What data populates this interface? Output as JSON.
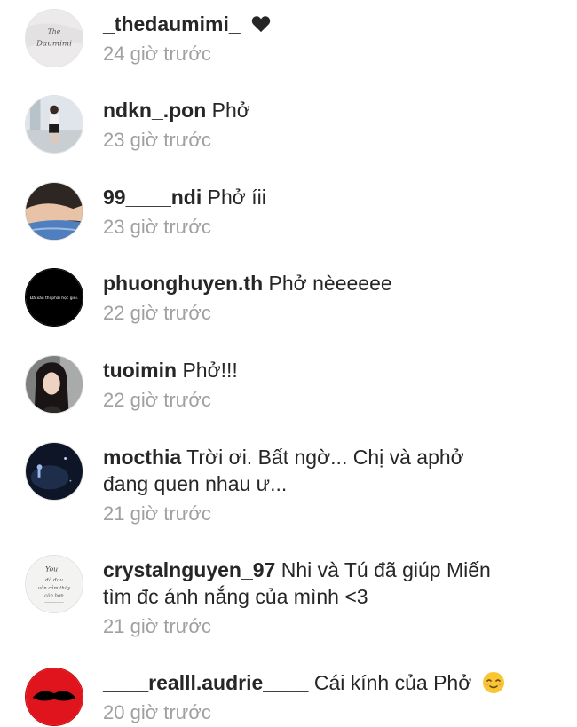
{
  "comments": [
    {
      "username": "_thedaumimi_",
      "text": "",
      "time": "24 giờ trước",
      "avatar": "calligraphy-avatar",
      "avatar_text": "The Daumimi",
      "trailing_icon": "heart-icon"
    },
    {
      "username": "ndkn_.pon",
      "text": "Phở",
      "time": "23 giờ trước",
      "avatar": "girl-standing-avatar"
    },
    {
      "username": "99____ndi",
      "text": "Phở íii",
      "time": "23 giờ trước",
      "avatar": "legs-denim-avatar"
    },
    {
      "username": "phuonghuyen.th",
      "text": "Phở nèeeeee",
      "time": "22 giờ trước",
      "avatar": "black-text-avatar",
      "avatar_text": "Đã xấu thì phải học giỏi."
    },
    {
      "username": "tuoimin",
      "text": "Phở!!!",
      "time": "22 giờ trước",
      "avatar": "girl-portrait-avatar"
    },
    {
      "username": "mocthia",
      "text": "Trời ơi. Bất ngờ... Chị và aphở",
      "text_line2": "đang quen nhau ư...",
      "time": "21 giờ trước",
      "avatar": "stage-concert-avatar"
    },
    {
      "username": "crystalnguyen_97",
      "text": "Nhi và Tú đã giúp Miến",
      "text_line2": "tìm đc ánh nắng của mình <3",
      "time": "21 giờ trước",
      "avatar": "quote-avatar",
      "avatar_text": [
        "You",
        "đã đau",
        "vẫn cảm thấy",
        "còn hơn"
      ]
    },
    {
      "username": "____realll.audrie____",
      "text": "Cái kính của Phở",
      "time": "20 giờ trước",
      "avatar": "red-lips-avatar",
      "trailing_icon": "smiling-emoji-icon"
    }
  ],
  "colors": {
    "username": "#262626",
    "timestamp": "#a0a0a0",
    "heart": "#262626",
    "emoji": "#f9c531"
  }
}
